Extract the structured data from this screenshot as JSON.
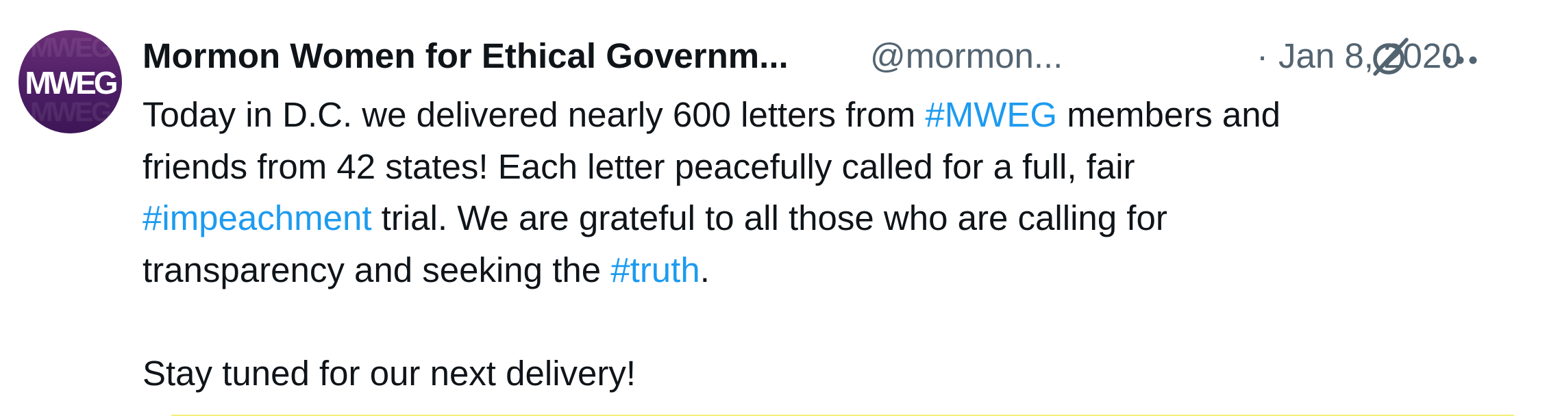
{
  "author": {
    "avatar_text": "MWEG",
    "display_name": "Mormon Women for Ethical Governm...",
    "handle": "@mormon...",
    "separator": "·",
    "date": "Jan 8, 2020"
  },
  "tweet": {
    "line1_a": "Today in D.C. we delivered nearly 600 letters from ",
    "hashtag_mweg": "#MWEG",
    "line1_b": " members and",
    "line2": "friends from 42 states! Each letter peacefully called for a full, fair",
    "hashtag_impeachment": "#impeachment",
    "line3_b": " trial. We are grateful to all those who are calling for",
    "line4_a": "transparency and seeking the ",
    "hashtag_truth": "#truth",
    "line4_b": ".",
    "line6": "Stay tuned for our next delivery!"
  },
  "icons": {
    "grok": "grok-icon",
    "more": "more-icon"
  },
  "colors": {
    "text": "#0f1419",
    "secondary": "#536471",
    "link": "#1d9bf0",
    "avatar": "#5a2470"
  }
}
